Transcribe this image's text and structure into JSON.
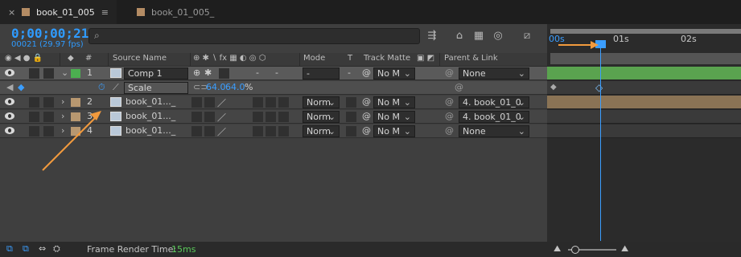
{
  "tabs": [
    {
      "label": "book_01_005",
      "color": "#b48c64",
      "active": true,
      "close": "×",
      "menu": "≡"
    },
    {
      "label": "book_01_005_",
      "color": "#b48c64",
      "active": false
    }
  ],
  "timecode": "0;00;00;21",
  "frame_info": "00021 (29.97 fps)",
  "search": {
    "icon": "search-icon",
    "value": ""
  },
  "toolbar_icons": [
    "composition-mini-flowchart-icon",
    "draft-3d-icon",
    "frame-blending-icon",
    "motion-blur-icon",
    "graph-editor-icon"
  ],
  "columns": {
    "source_name": "Source Name",
    "mode": "Mode",
    "t": "T",
    "track_matte": "Track Matte",
    "parent_link": "Parent & Link",
    "number": "#"
  },
  "layers": [
    {
      "num": "1",
      "name": "Comp 1",
      "label_color": "#4caf50",
      "mode": "-",
      "matte": "No M",
      "parent": "None",
      "expanded": true,
      "selected": true
    },
    {
      "num": "2",
      "name": "book_01..._",
      "label_color": "#b89870",
      "mode": "Norm",
      "matte": "No M",
      "parent": "4. book_01_0",
      "expanded": false
    },
    {
      "num": "3",
      "name": "book_01..._",
      "label_color": "#b89870",
      "mode": "Norm",
      "matte": "No M",
      "parent": "4. book_01_0",
      "expanded": false
    },
    {
      "num": "4",
      "name": "book_01..._",
      "label_color": "#b89870",
      "mode": "Norm",
      "matte": "No M",
      "parent": "None",
      "expanded": false
    }
  ],
  "property": {
    "name": "Scale",
    "value_x": "64.0",
    "value_y": "64.0",
    "unit": "%"
  },
  "ruler": {
    "labels": [
      "00s",
      "01s",
      "02s"
    ]
  },
  "bottom": {
    "label": "Frame Render Time:",
    "value": "15ms"
  }
}
